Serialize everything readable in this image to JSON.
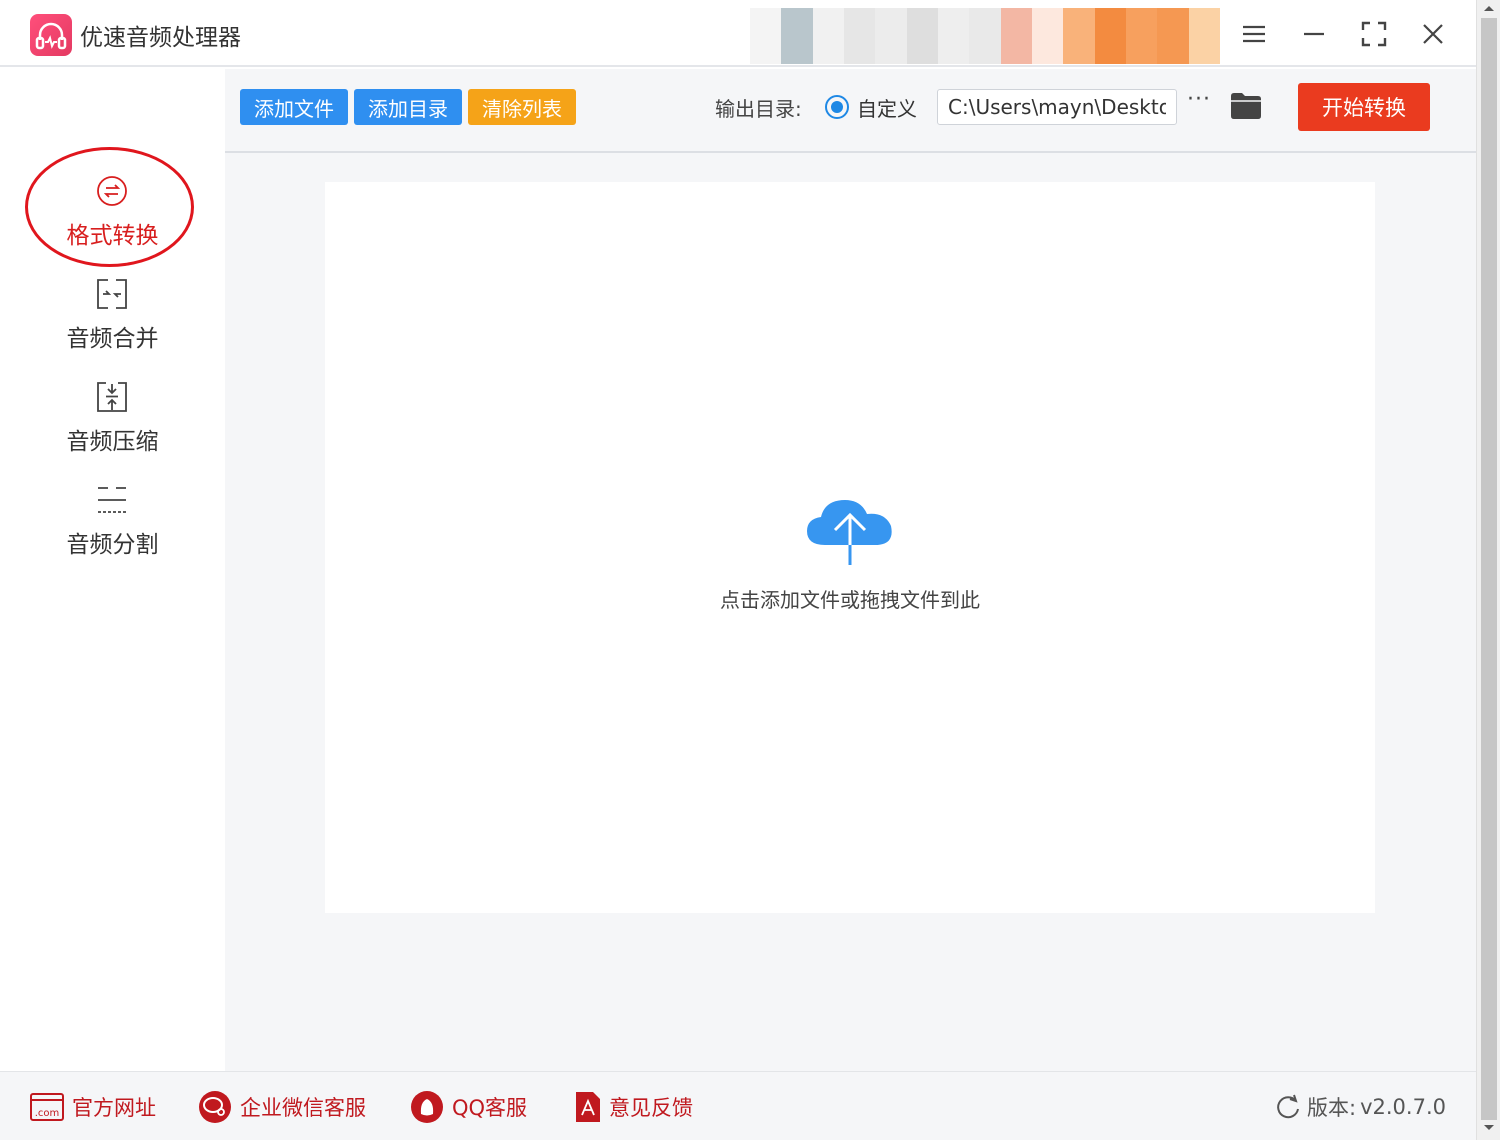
{
  "app": {
    "title": "优速音频处理器",
    "brand_color": "#e8395f"
  },
  "sidebar": {
    "items": [
      {
        "label": "格式转换",
        "icon": "format-convert-icon",
        "active": true
      },
      {
        "label": "音频合并",
        "icon": "merge-icon",
        "active": false
      },
      {
        "label": "音频压缩",
        "icon": "compress-icon",
        "active": false
      },
      {
        "label": "音频分割",
        "icon": "split-icon",
        "active": false
      }
    ]
  },
  "toolbar": {
    "add_file_label": "添加文件",
    "add_dir_label": "添加目录",
    "clear_list_label": "清除列表",
    "output_label": "输出目录:",
    "custom_label": "自定义",
    "output_path": "C:\\Users\\mayn\\Desktop",
    "more_label": "···",
    "start_label": "开始转换"
  },
  "dropzone": {
    "hint": "点击添加文件或拖拽文件到此"
  },
  "footer": {
    "website_label": "官方网址",
    "wechat_label": "企业微信客服",
    "qq_label": "QQ客服",
    "feedback_label": "意见反馈",
    "version_label": "版本:",
    "version_value": "v2.0.7.0"
  },
  "colors": {
    "blue_button": "#2f8ff0",
    "orange_button": "#f5a318",
    "start_button": "#ea3b1f",
    "active_red": "#d81e1e"
  }
}
